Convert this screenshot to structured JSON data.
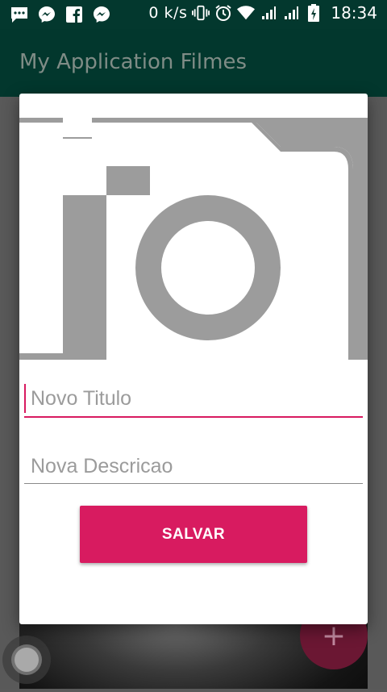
{
  "status_bar": {
    "notification_icons": [
      "chat-bubble-icon",
      "messenger-icon",
      "facebook-icon",
      "messenger-icon"
    ],
    "network_speed": "0 k/s",
    "system_icons": [
      "vibrate-icon",
      "alarm-icon",
      "wifi-icon",
      "signal-icon",
      "signal-icon",
      "battery-charging-icon"
    ],
    "time": "18:34"
  },
  "app_bar": {
    "title": "My Application Filmes"
  },
  "dialog": {
    "image_placeholder_icon": "camera-icon",
    "title_field": {
      "placeholder": "Novo Titulo",
      "value": ""
    },
    "description_field": {
      "placeholder": "Nova Descricao",
      "value": ""
    },
    "save_label": "SALVAR"
  },
  "fab": {
    "icon": "plus-icon",
    "label": "+"
  },
  "colors": {
    "status_bar": "#03382e",
    "app_bar": "#02372d",
    "accent": "#d81b60",
    "camera_gray": "#9c9c9c"
  }
}
